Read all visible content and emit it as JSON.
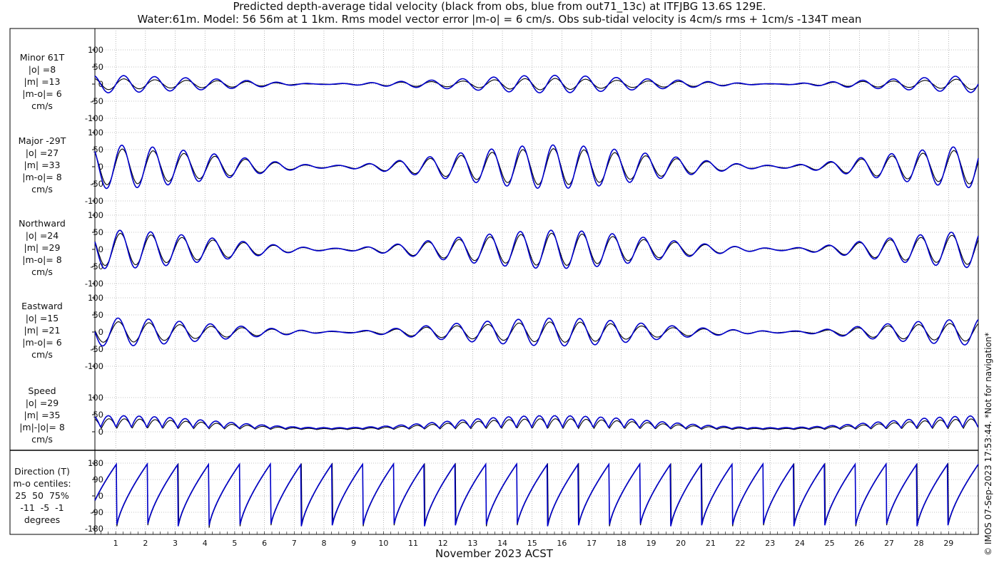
{
  "header": {
    "title_line1": "Predicted depth-average tidal velocity (black from obs, blue from out71_13c) at ITFJBG 13.6S 129E.",
    "title_line2": "Water:61m. Model: 56 56m at 1 1km. Rms model vector error |m-o| = 6 cm/s. Obs sub-tidal velocity is 4cm/s rms + 1cm/s -134T mean"
  },
  "xaxis_label": "November 2023 ACST",
  "copyright": "© IMOS 07-Sep-2023 17:53:44. *Not for navigation*",
  "colors": {
    "obs": "#000000",
    "model": "#0000cc",
    "grid": "#888888"
  },
  "panels": [
    {
      "lines": [
        "Minor 61T",
        "|o| =8",
        "|m| =13",
        "|m-o|= 6",
        "cm/s"
      ]
    },
    {
      "lines": [
        "Major -29T",
        "|o| =27",
        "|m| =33",
        "|m-o|= 8",
        "cm/s"
      ]
    },
    {
      "lines": [
        "Northward",
        "|o| =24",
        "|m| =29",
        "|m-o|= 8",
        "cm/s"
      ]
    },
    {
      "lines": [
        "Eastward",
        "|o| =15",
        "|m| =21",
        "|m-o|= 6",
        "cm/s"
      ]
    },
    {
      "lines": [
        "Speed",
        "|o| =29",
        "|m| =35",
        "|m|-|o|= 8",
        "cm/s"
      ]
    },
    {
      "lines": [
        "Direction (T)",
        "m-o centiles:",
        "25  50  75%",
        "-11  -5  -1",
        "degrees"
      ]
    }
  ],
  "chart_data": [
    {
      "type": "line",
      "name": "Minor 61T",
      "ylim": [
        -100,
        100
      ],
      "yticks": [
        -100,
        -50,
        0,
        50,
        100
      ],
      "xlim": [
        0.3,
        30.0
      ],
      "obs_amp": 8,
      "model_amp": 13
    },
    {
      "type": "line",
      "name": "Major -29T",
      "ylim": [
        -100,
        100
      ],
      "yticks": [
        -100,
        -50,
        0,
        50,
        100
      ],
      "xlim": [
        0.3,
        30.0
      ],
      "obs_amp": 27,
      "model_amp": 33
    },
    {
      "type": "line",
      "name": "Northward",
      "ylim": [
        -100,
        100
      ],
      "yticks": [
        -100,
        -50,
        0,
        50,
        100
      ],
      "xlim": [
        0.3,
        30.0
      ],
      "obs_amp": 24,
      "model_amp": 29
    },
    {
      "type": "line",
      "name": "Eastward",
      "ylim": [
        -100,
        100
      ],
      "yticks": [
        -100,
        -50,
        0,
        50,
        100
      ],
      "xlim": [
        0.3,
        30.0
      ],
      "obs_amp": 15,
      "model_amp": 21
    },
    {
      "type": "line",
      "name": "Speed",
      "ylim": [
        0,
        100
      ],
      "yticks": [
        0,
        50,
        100
      ],
      "xlim": [
        0.3,
        30.0
      ],
      "obs_amp": 29,
      "model_amp": 35
    },
    {
      "type": "line",
      "name": "Direction (T)",
      "ylim": [
        -180,
        180
      ],
      "yticks": [
        -180,
        -90,
        0,
        90,
        180
      ],
      "xlim": [
        0.3,
        30.0
      ]
    }
  ],
  "xticks": [
    "1",
    "2",
    "3",
    "4",
    "5",
    "6",
    "7",
    "8",
    "9",
    "10",
    "11",
    "12",
    "13",
    "14",
    "15",
    "16",
    "17",
    "18",
    "19",
    "20",
    "21",
    "22",
    "23",
    "24",
    "25",
    "26",
    "27",
    "28",
    "29"
  ]
}
